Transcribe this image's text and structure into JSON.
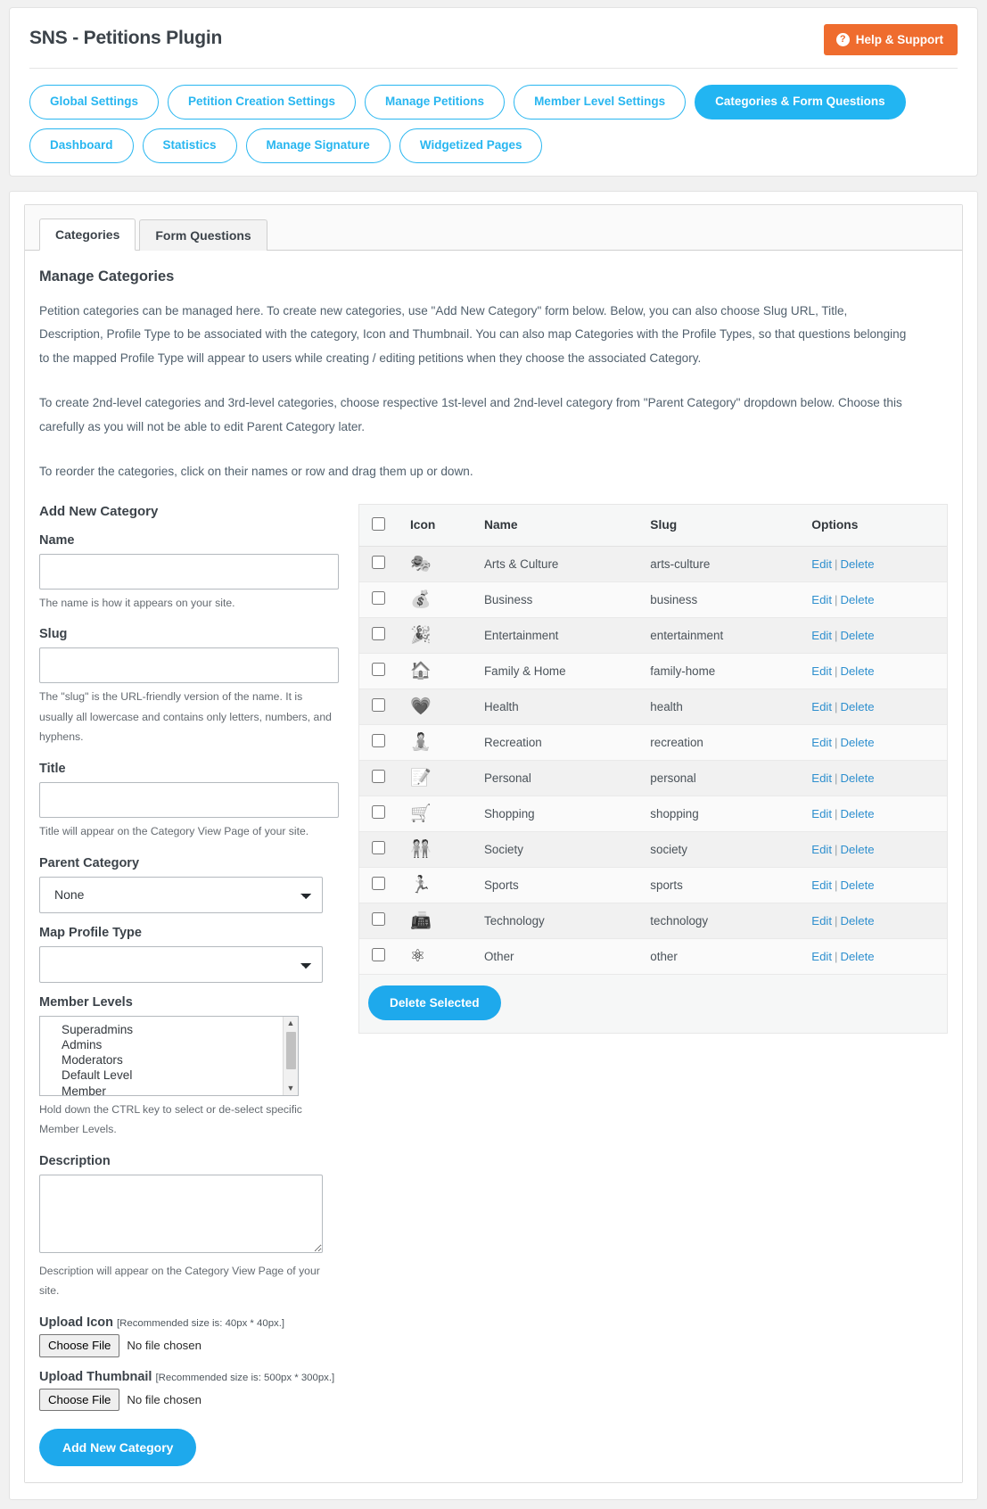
{
  "header": {
    "app_title": "SNS - Petitions Plugin",
    "help_label": "Help & Support",
    "help_icon_glyph": "?"
  },
  "nav": {
    "rows": [
      [
        {
          "label": "Global Settings",
          "active": false
        },
        {
          "label": "Petition Creation Settings",
          "active": false
        },
        {
          "label": "Manage Petitions",
          "active": false
        },
        {
          "label": "Member Level Settings",
          "active": false
        },
        {
          "label": "Categories & Form Questions",
          "active": true
        }
      ],
      [
        {
          "label": "Dashboard",
          "active": false
        },
        {
          "label": "Statistics",
          "active": false
        },
        {
          "label": "Manage Signature",
          "active": false
        },
        {
          "label": "Widgetized Pages",
          "active": false
        }
      ]
    ]
  },
  "subtabs": [
    {
      "label": "Categories",
      "active": true
    },
    {
      "label": "Form Questions",
      "active": false
    }
  ],
  "panel": {
    "section_title": "Manage Categories",
    "paragraph_1": "Petition categories can be managed here. To create new categories, use \"Add New Category\" form below. Below, you can also choose Slug URL, Title, Description, Profile Type to be associated with the category, Icon and Thumbnail. You can also map Categories with the Profile Types, so that questions belonging to the mapped Profile Type will appear to users while creating / editing petitions when they choose the associated Category.",
    "paragraph_2": "To create 2nd-level categories and 3rd-level categories, choose respective 1st-level and 2nd-level category from \"Parent Category\" dropdown below. Choose this carefully as you will not be able to edit Parent Category later.",
    "paragraph_3": "To reorder the categories, click on their names or row and drag them up or down."
  },
  "form": {
    "heading": "Add New Category",
    "name_label": "Name",
    "name_value": "",
    "name_helper": "The name is how it appears on your site.",
    "slug_label": "Slug",
    "slug_value": "",
    "slug_helper": "The \"slug\" is the URL-friendly version of the name. It is usually all lowercase and contains only letters, numbers, and hyphens.",
    "title_label": "Title",
    "title_value": "",
    "title_helper": "Title will appear on the Category View Page of your site.",
    "parent_label": "Parent Category",
    "parent_value": "None",
    "parent_options": [
      "None"
    ],
    "profile_label": "Map Profile Type",
    "profile_value": "",
    "profile_options": [
      ""
    ],
    "member_levels_label": "Member Levels",
    "member_levels": [
      "Superadmins",
      "Admins",
      "Moderators",
      "Default Level",
      "Member"
    ],
    "member_levels_helper": "Hold down the CTRL key to select or de-select specific Member Levels.",
    "description_label": "Description",
    "description_value": "",
    "description_helper": "Description will appear on the Category View Page of your site.",
    "upload_icon_label": "Upload Icon",
    "upload_icon_rec": "[Recommended size is: 40px * 40px.]",
    "upload_thumb_label": "Upload Thumbnail",
    "upload_thumb_rec": "[Recommended size is: 500px * 300px.]",
    "choose_file_label": "Choose File",
    "no_file_label": "No file chosen",
    "submit_label": "Add New Category"
  },
  "table": {
    "columns": [
      "",
      "Icon",
      "Name",
      "Slug",
      "Options"
    ],
    "edit_label": "Edit",
    "delete_label": "Delete",
    "separator": "|",
    "delete_selected_label": "Delete Selected",
    "rows": [
      {
        "icon": "🎭",
        "icon_name": "performing-arts-icon",
        "name": "Arts & Culture",
        "slug": "arts-culture"
      },
      {
        "icon": "💰",
        "icon_name": "money-hand-icon",
        "name": "Business",
        "slug": "business"
      },
      {
        "icon": "🎉",
        "icon_name": "party-popper-icon",
        "name": "Entertainment",
        "slug": "entertainment"
      },
      {
        "icon": "🏠",
        "icon_name": "house-icon",
        "name": "Family & Home",
        "slug": "family-home"
      },
      {
        "icon": "💗",
        "icon_name": "heart-pulse-icon",
        "name": "Health",
        "slug": "health"
      },
      {
        "icon": "🧘",
        "icon_name": "meditation-icon",
        "name": "Recreation",
        "slug": "recreation"
      },
      {
        "icon": "📝",
        "icon_name": "memo-icon",
        "name": "Personal",
        "slug": "personal"
      },
      {
        "icon": "🛒",
        "icon_name": "shopping-cart-icon",
        "name": "Shopping",
        "slug": "shopping"
      },
      {
        "icon": "🧑‍🤝‍🧑",
        "icon_name": "people-icon",
        "name": "Society",
        "slug": "society"
      },
      {
        "icon": "🏃",
        "icon_name": "runner-icon",
        "name": "Sports",
        "slug": "sports"
      },
      {
        "icon": "📠",
        "icon_name": "fax-machine-icon",
        "name": "Technology",
        "slug": "technology"
      },
      {
        "icon": "⚛",
        "icon_name": "atom-icon",
        "name": "Other",
        "slug": "other"
      }
    ]
  },
  "colors": {
    "accent_blue": "#22b5f2",
    "pill_border": "#28b6f0",
    "orange": "#ef6c2e",
    "link_blue": "#2e8fce",
    "text": "#3c434a"
  }
}
